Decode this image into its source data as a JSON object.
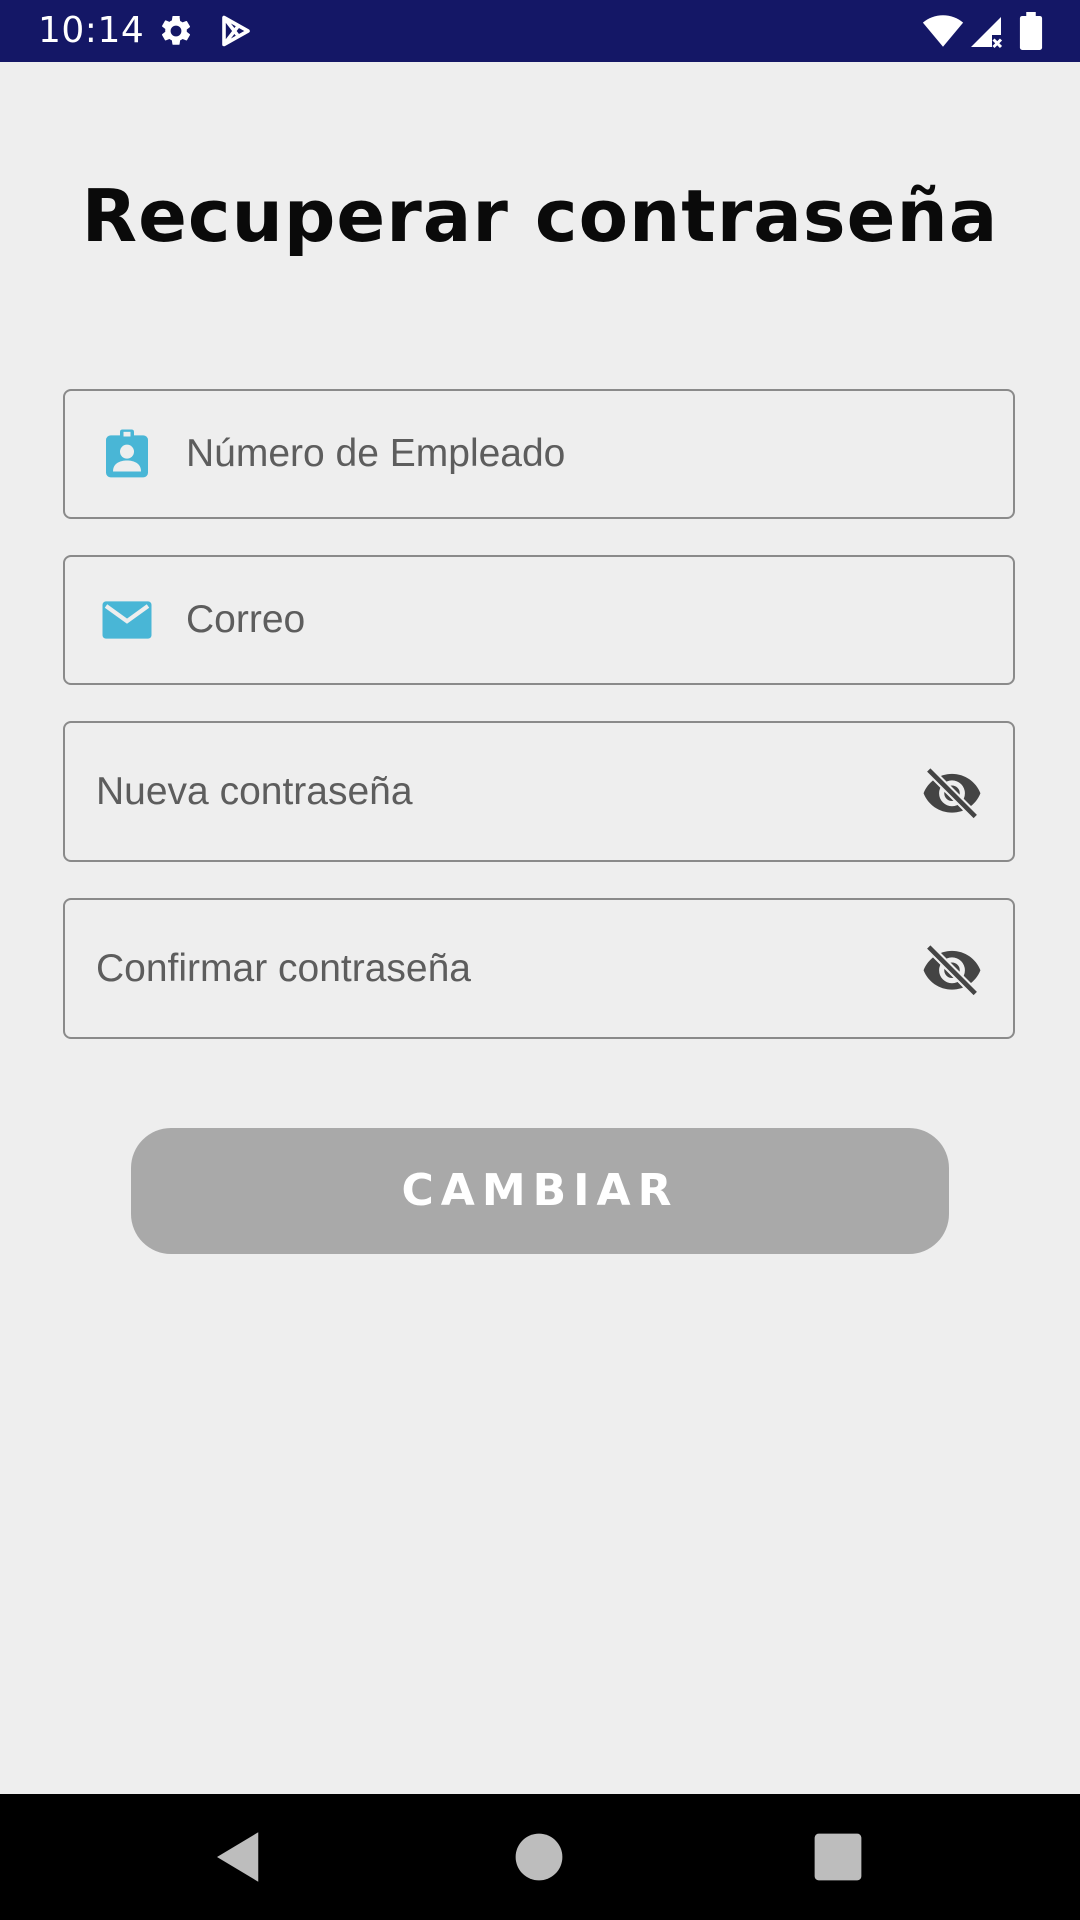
{
  "status_bar": {
    "time": "10:14",
    "icons": [
      "gear-icon",
      "play-store-icon",
      "wifi-icon",
      "signal-icon",
      "battery-icon"
    ],
    "background": "#141766"
  },
  "screen": {
    "title": "Recuperar contraseña"
  },
  "form": {
    "employee_number": {
      "placeholder": "Número de Empleado",
      "icon": "employee-badge-icon"
    },
    "email": {
      "placeholder": "Correo",
      "icon": "mail-icon"
    },
    "new_password": {
      "placeholder": "Nueva contraseña",
      "toggle_icon": "visibility-off-icon"
    },
    "confirm_password": {
      "placeholder": "Confirmar contraseña",
      "toggle_icon": "visibility-off-icon"
    },
    "submit_label": "CAMBIAR",
    "accent_color": "#49b6d6",
    "button_color": "#a9a9a9"
  },
  "nav_bar": {
    "icons": [
      "back-icon",
      "home-icon",
      "recents-icon"
    ]
  }
}
